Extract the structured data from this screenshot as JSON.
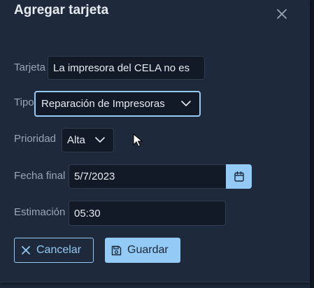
{
  "dialog": {
    "title": "Agregar tarjeta",
    "close_icon": "close-icon"
  },
  "form": {
    "card": {
      "label": "Tarjeta",
      "value": "La impresora del CELA no es"
    },
    "type": {
      "label": "Tipo",
      "selected": "Reparación de Impresoras"
    },
    "priority": {
      "label": "Prioridad",
      "selected": "Alta"
    },
    "due_date": {
      "label": "Fecha final",
      "value": "5/7/2023",
      "icon": "calendar-icon"
    },
    "estimate": {
      "label": "Estimación",
      "value": "05:30"
    }
  },
  "actions": {
    "cancel_label": "Cancelar",
    "cancel_icon": "close-icon",
    "save_label": "Guardar",
    "save_icon": "save-icon"
  },
  "colors": {
    "accent": "#93cbf6",
    "background": "#1e2a3b",
    "field_bg": "#111a26"
  }
}
